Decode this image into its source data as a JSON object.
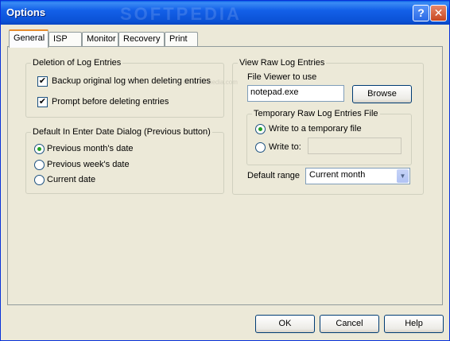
{
  "window": {
    "title": "Options",
    "help_glyph": "?",
    "close_glyph": "✕",
    "watermark": "SOFTPEDIA",
    "watermark_url": "www.softpedia.com"
  },
  "tabs": [
    {
      "label": "General",
      "active": true
    },
    {
      "label": "ISP"
    },
    {
      "label": "Monitor"
    },
    {
      "label": "Recovery"
    },
    {
      "label": "Print"
    }
  ],
  "deletion": {
    "legend": "Deletion of Log Entries",
    "backup_label": "Backup original log when deleting entries",
    "backup_checked": true,
    "prompt_label": "Prompt before deleting entries",
    "prompt_checked": true,
    "check_glyph": "✔"
  },
  "date_dialog": {
    "legend": "Default In Enter Date Dialog (Previous button)",
    "options": [
      "Previous month's date",
      "Previous week's date",
      "Current date"
    ],
    "selected_index": 0
  },
  "raw_log": {
    "legend": "View Raw Log Entries",
    "viewer_label": "File Viewer to use",
    "viewer_value": "notepad.exe",
    "browse_label": "Browse",
    "temp_legend": "Temporary Raw Log Entries File",
    "temp_options": [
      "Write to a temporary file",
      "Write to:"
    ],
    "temp_selected_index": 0,
    "write_to_value": "",
    "range_label": "Default range",
    "range_value": "Current month",
    "arrow_glyph": "▼"
  },
  "footer": {
    "ok_label": "OK",
    "cancel_label": "Cancel",
    "help_label": "Help"
  },
  "colors": {
    "titlebar": "#0b52d6",
    "face": "#ece9d8",
    "radio_dot": "#21a121",
    "active_tab_accent": "#e68b2c"
  }
}
